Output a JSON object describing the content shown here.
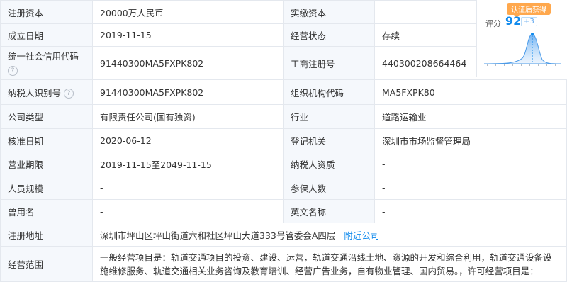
{
  "rows": [
    {
      "k1": "注册资本",
      "v1": "20000万人民币",
      "k2": "实缴资本",
      "v2": "-"
    },
    {
      "k1": "成立日期",
      "v1": "2019-11-15",
      "k2": "经营状态",
      "v2": "存续"
    },
    {
      "k1": "统一社会信用代码",
      "v1": "91440300MA5FXPK802",
      "k2": "工商注册号",
      "v2": "440300208664464"
    },
    {
      "k1": "纳税人识别号",
      "v1": "91440300MA5FXPK802",
      "k2": "组织机构代码",
      "v2": "MA5FXPK80"
    },
    {
      "k1": "公司类型",
      "v1": "有限责任公司(国有独资)",
      "k2": "行业",
      "v2": "道路运输业"
    },
    {
      "k1": "核准日期",
      "v1": "2020-06-12",
      "k2": "登记机关",
      "v2": "深圳市市场监督管理局"
    },
    {
      "k1": "营业期限",
      "v1": "2019-11-15至2049-11-15",
      "k2": "纳税人资质",
      "v2": "-"
    },
    {
      "k1": "人员规模",
      "v1": "-",
      "k2": "参保人数",
      "v2": "-"
    },
    {
      "k1": "曾用名",
      "v1": "-",
      "k2": "英文名称",
      "v2": "-"
    }
  ],
  "address": {
    "label": "注册地址",
    "value": "深圳市坪山区坪山街道六和社区坪山大道333号管委会A四层",
    "link": "附近公司"
  },
  "scope": {
    "label": "经营范围",
    "value": "一般经营项目是：轨道交通项目的投资、建设、运营，轨道交通沿线土地、资源的开发和综合利用，轨道交通设备设施维修服务、轨道交通相关业务咨询及教育培训、经营广告业务，自有物业管理、国内贸易。，许可经营项目是："
  },
  "help_icon": "?",
  "score": {
    "badge": "认证后获得",
    "label": "评分",
    "value": "92",
    "delta": "+3"
  },
  "colors": {
    "accent": "#128bed",
    "badge": "#ffa84d",
    "key_bg": "#f5f8fc",
    "border": "#e4e8ee"
  }
}
